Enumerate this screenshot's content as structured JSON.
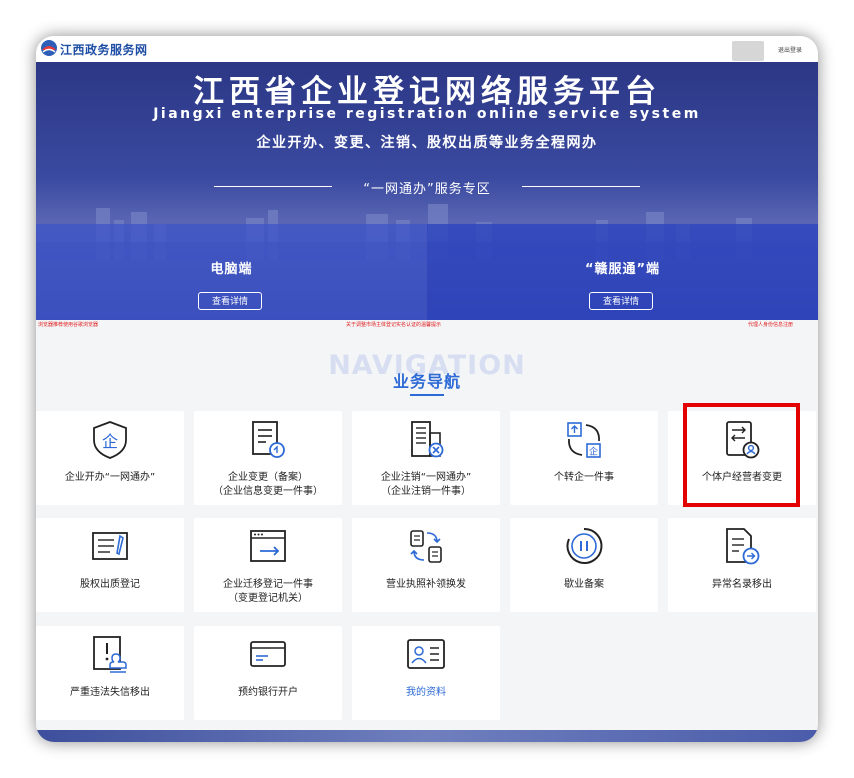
{
  "header": {
    "site_name": "江西政务服务网",
    "logout": "退出登录"
  },
  "banner": {
    "title": "江西省企业登记网络服务平台",
    "subtitle_en": "Jiangxi enterprise registration online service system",
    "subtitle_cn": "企业开办、变更、注销、股权出质等业务全程网办",
    "zone_title": "“一网通办”服务专区",
    "panels": [
      {
        "title": "电脑端",
        "button": "查看详情"
      },
      {
        "title": "“赣服通”端",
        "button": "查看详情"
      }
    ]
  },
  "notices": [
    "浏览器推荐使用谷歌浏览器",
    "关于调整市场主体登记实名认证的温馨提示",
    "代理人身份信息注册"
  ],
  "navigation": {
    "bg_text": "NAVIGATION",
    "title": "业务导航",
    "items": [
      {
        "label": "企业开办“一网通办”",
        "icon": "shield-enterprise-icon"
      },
      {
        "label": "企业变更（备案）",
        "label2": "（企业信息变更一件事）",
        "icon": "document-refresh-icon"
      },
      {
        "label": "企业注销“一网通办”",
        "label2": "（企业注销一件事）",
        "icon": "building-cancel-icon"
      },
      {
        "label": "个转企一件事",
        "icon": "transfer-enterprise-icon"
      },
      {
        "label": "个体户经营者变更",
        "icon": "operator-change-icon"
      },
      {
        "label": "股权出质登记",
        "icon": "pledge-document-icon"
      },
      {
        "label": "企业迁移登记一件事",
        "label2": "（变更登记机关）",
        "icon": "browser-migrate-icon"
      },
      {
        "label": "营业执照补领换发",
        "icon": "license-exchange-icon"
      },
      {
        "label": "歇业备案",
        "icon": "pause-icon"
      },
      {
        "label": "异常名录移出",
        "icon": "document-export-icon"
      },
      {
        "label": "严重违法失信移出",
        "icon": "warning-stamp-icon"
      },
      {
        "label": "预约银行开户",
        "icon": "bank-card-icon"
      },
      {
        "label": "我的资料",
        "icon": "profile-card-icon"
      }
    ]
  },
  "colors": {
    "accent": "#2d6ad6",
    "highlight": "#e30000",
    "banner": "#2c3785"
  }
}
